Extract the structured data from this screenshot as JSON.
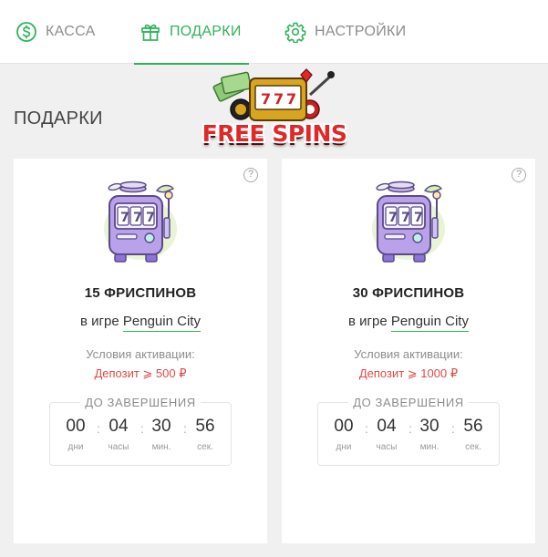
{
  "nav": {
    "tabs": [
      {
        "label": "КАССА",
        "icon": "dollar-icon",
        "active": false
      },
      {
        "label": "ПОДАРКИ",
        "icon": "gift-icon",
        "active": true
      },
      {
        "label": "НАСТРОЙКИ",
        "icon": "gear-icon",
        "active": false
      }
    ]
  },
  "page": {
    "title": "ПОДАРКИ"
  },
  "banner": {
    "word1": "FREE",
    "word2": "SPINS"
  },
  "colors": {
    "accent": "#2fb35a",
    "danger": "#e04848"
  },
  "gifts": [
    {
      "title": "15 ФРИСПИНОВ",
      "game_prefix": "в игре",
      "game": "Penguin City",
      "conditions_label": "Условия активации:",
      "conditions_value": "Депозит ⩾ 500 ₽",
      "reels": "777",
      "timer": {
        "label": "ДО ЗАВЕРШЕНИЯ",
        "days": "00",
        "hours": "04",
        "minutes": "30",
        "seconds": "56",
        "days_unit": "дни",
        "hours_unit": "часы",
        "minutes_unit": "мин.",
        "seconds_unit": "сек."
      }
    },
    {
      "title": "30 ФРИСПИНОВ",
      "game_prefix": "в игре",
      "game": "Penguin City",
      "conditions_label": "Условия активации:",
      "conditions_value": "Депозит ⩾ 1000 ₽",
      "reels": "777",
      "timer": {
        "label": "ДО ЗАВЕРШЕНИЯ",
        "days": "00",
        "hours": "04",
        "minutes": "30",
        "seconds": "56",
        "days_unit": "дни",
        "hours_unit": "часы",
        "minutes_unit": "мин.",
        "seconds_unit": "сек."
      }
    }
  ]
}
